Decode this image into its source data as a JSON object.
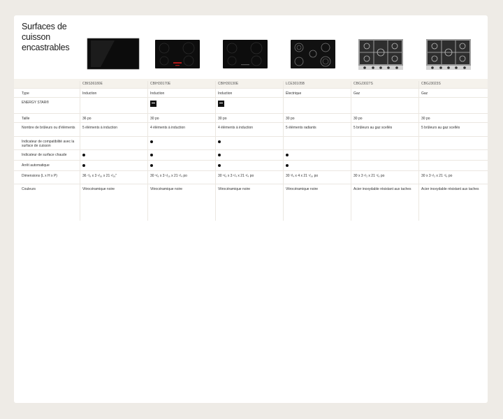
{
  "page": {
    "title": "Surfaces de cuisson encastrables"
  },
  "products": [
    {
      "sku": "CBIS36180E",
      "image": "induction-cooktop-36-icon"
    },
    {
      "sku": "CBIH30170E",
      "image": "induction-cooktop-30-red-controls-icon"
    },
    {
      "sku": "CBIH30130E",
      "image": "induction-cooktop-30-icon"
    },
    {
      "sku": "LCE30105B",
      "image": "radiant-electric-cooktop-icon"
    },
    {
      "sku": "CBGJ3027S",
      "image": "gas-cooktop-5-burner-icon"
    },
    {
      "sku": "CBGJ3023S",
      "image": "gas-cooktop-5-burner-alt-icon"
    }
  ],
  "rows": [
    {
      "label": "Type",
      "values": [
        "Induction",
        "Induction",
        "Induction",
        "Électrique",
        "Gaz",
        "Gaz"
      ]
    },
    {
      "label": "ENERGY STAR®",
      "values": [
        "",
        "energy-star-icon",
        "energy-star-icon",
        "",
        "",
        ""
      ]
    },
    {
      "label": "Taille",
      "values": [
        "36 po",
        "30 po",
        "30 po",
        "30 po",
        "30 po",
        "30 po"
      ]
    },
    {
      "label": "Nombre de brûleurs ou d'éléments",
      "values": [
        "5 éléments à induction",
        "4 éléments à induction",
        "4 éléments à induction",
        "5 éléments radiants",
        "5 brûleurs au gaz scellés",
        "5 brûleurs au gaz scellés"
      ]
    },
    {
      "label": "Indicateur de compatibilité avec la surface de cuisson",
      "values": [
        "",
        "●",
        "●",
        "",
        "",
        ""
      ]
    },
    {
      "label": "Indicateur de surface chaude",
      "values": [
        "●",
        "●",
        "●",
        "●",
        "",
        ""
      ]
    },
    {
      "label": "Arrêt automatique",
      "values": [
        "●",
        "●",
        "●",
        "●",
        "",
        ""
      ]
    },
    {
      "label": "Dimensions (L x H x P)",
      "values": [
        "36 ⁷/₈ x 3 ¹/₁₆ x 21 ¹/₁₆\"",
        "30 ⁵/₈ x 3 ¹/₁₆ x 21 ¹/₄ po",
        "30 ⁵/₈ x 3 ¹/₄ x 21 ¹/₄ po",
        "30 ³/₄ x 4 x 21 ⁷/₁₆ po",
        "30 x 3 ¹/₂ x 21 ⁷/₈ po",
        "30 x 3 ¹/₂ x 21 ⁷/₈ po"
      ]
    },
    {
      "label": "Couleurs",
      "values": [
        "Vitrocéramique noire",
        "Vitrocéramique noire",
        "Vitrocéramique noire",
        "Vitrocéramique noire",
        "Acier inoxydable résistant aux taches",
        "Acier inoxydable résistant aux taches"
      ]
    }
  ]
}
